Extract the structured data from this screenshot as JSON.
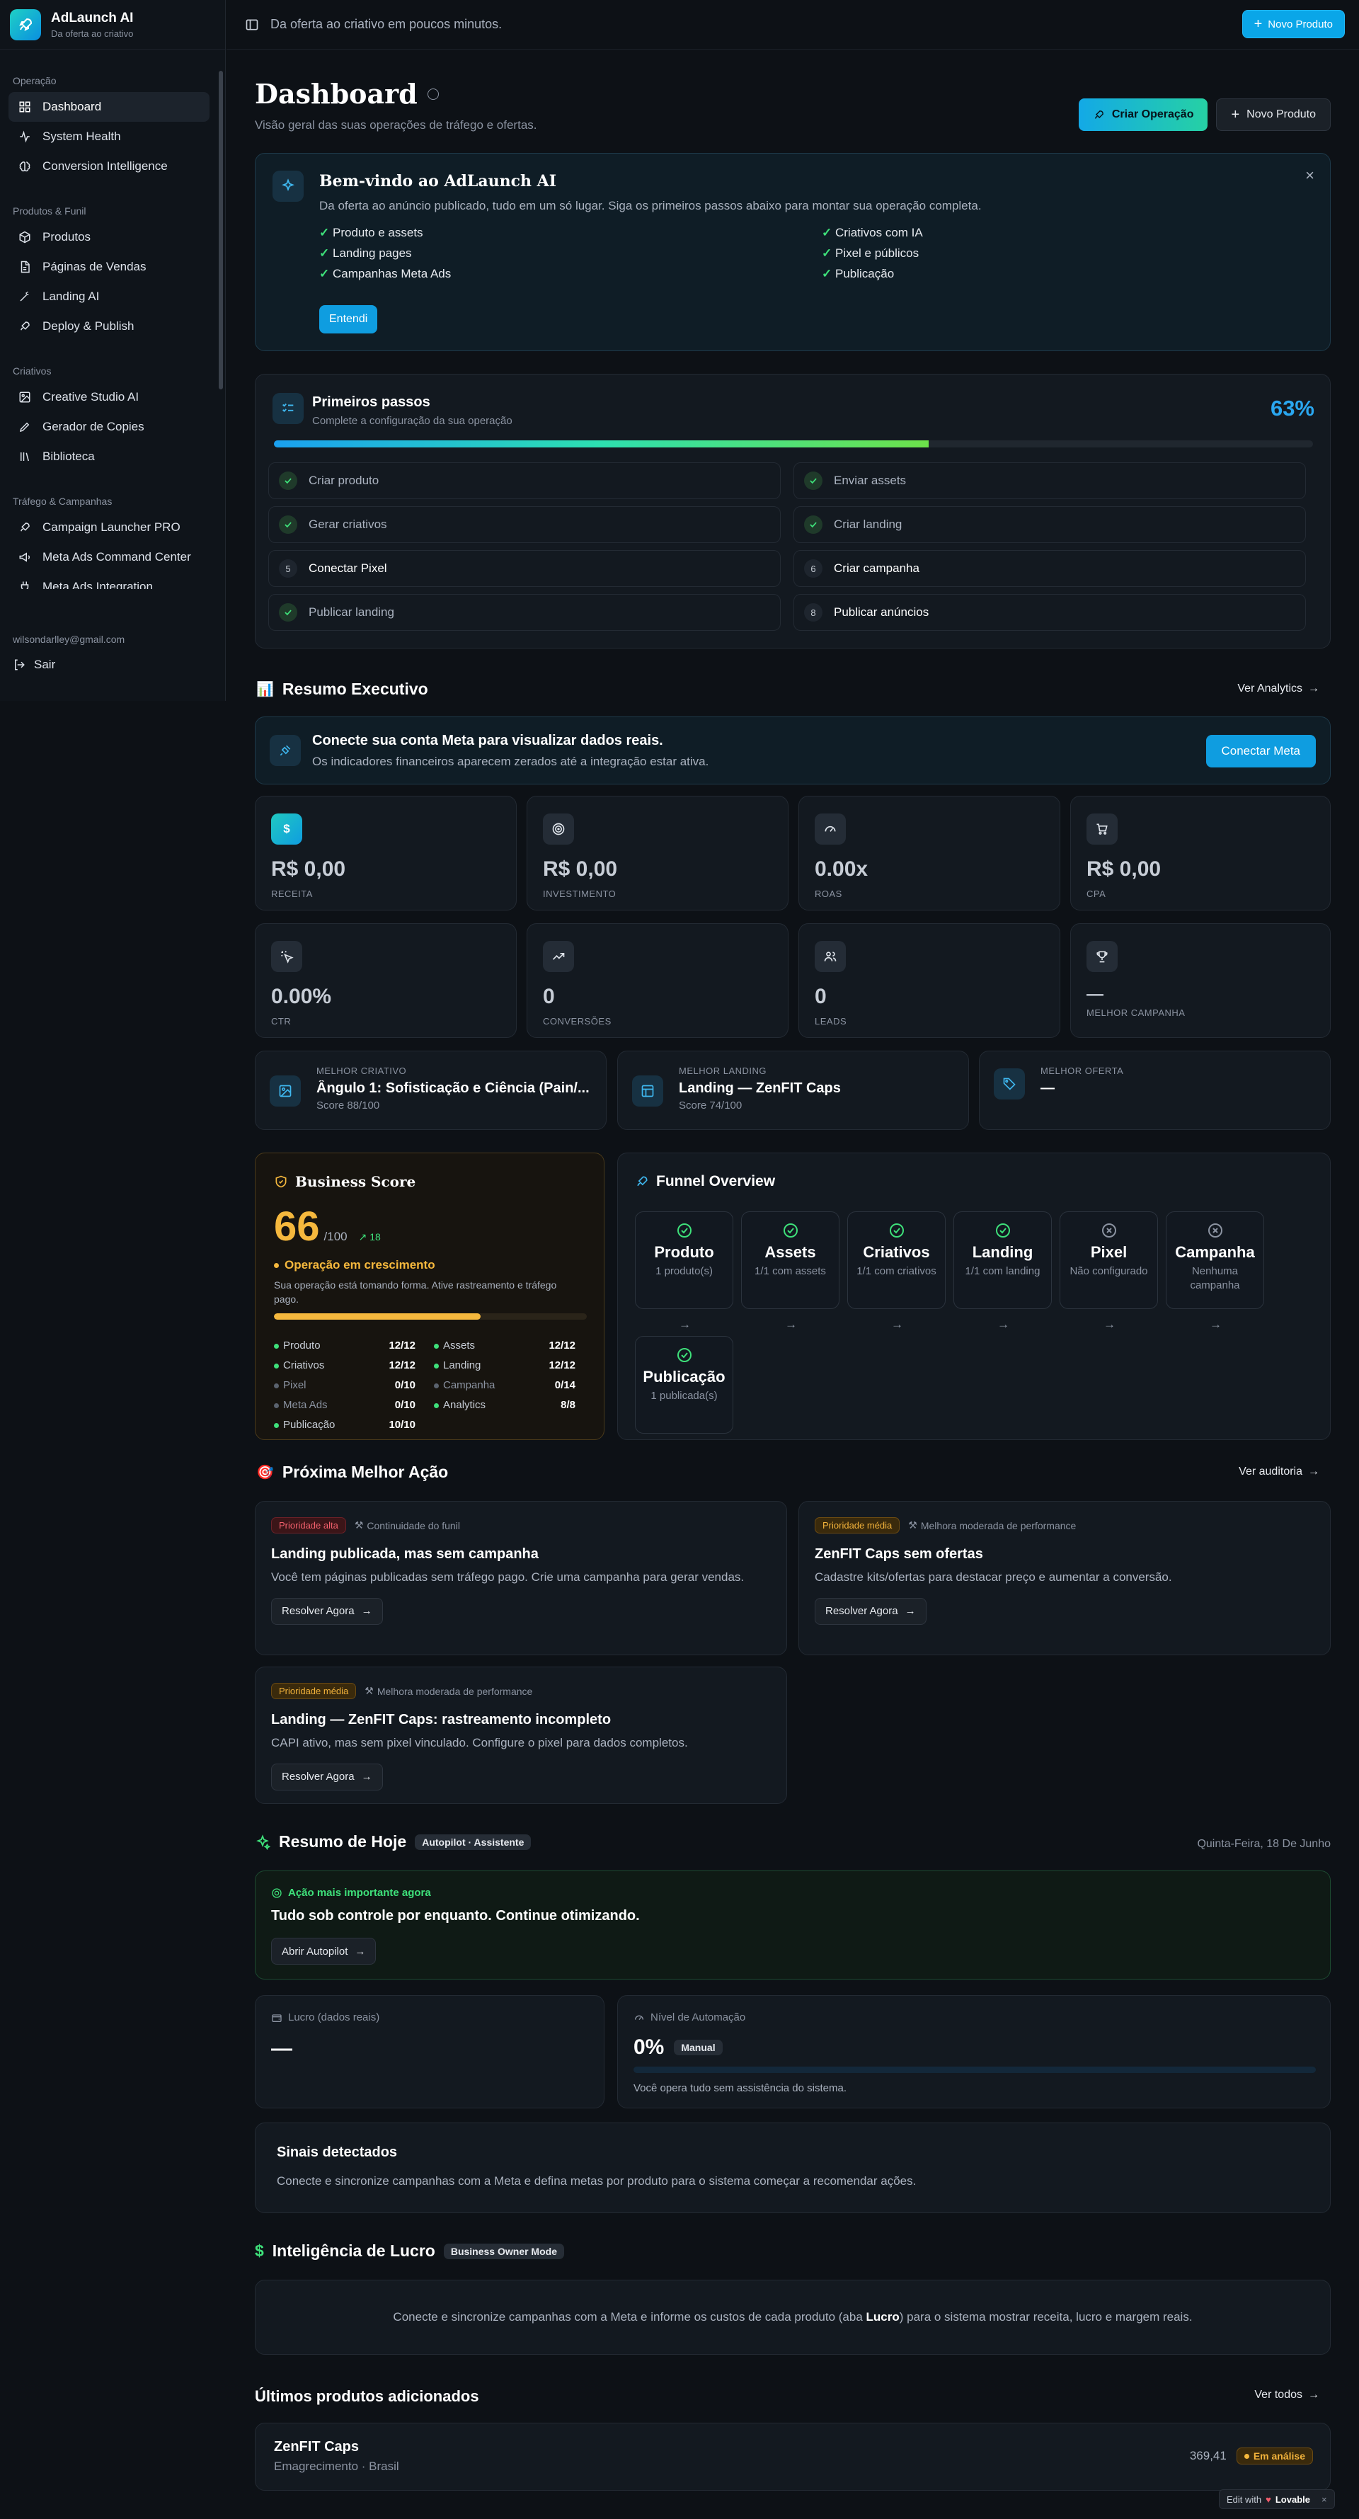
{
  "sidebar": {
    "brand_title": "AdLaunch AI",
    "brand_subtitle": "Da oferta ao criativo",
    "sections": [
      {
        "title": "Operação",
        "items": [
          "Dashboard",
          "System Health",
          "Conversion Intelligence"
        ]
      },
      {
        "title": "Produtos & Funil",
        "items": [
          "Produtos",
          "Páginas de Vendas",
          "Landing AI",
          "Deploy & Publish"
        ]
      },
      {
        "title": "Criativos",
        "items": [
          "Creative Studio AI",
          "Gerador de Copies",
          "Biblioteca"
        ]
      },
      {
        "title": "Tráfego & Campanhas",
        "items": [
          "Campaign Launcher PRO",
          "Meta Ads Command Center",
          "Meta Ads Integration"
        ]
      }
    ],
    "email": "wilsondarlley@gmail.com",
    "logout": "Sair"
  },
  "topbar": {
    "tagline": "Da oferta ao criativo em poucos minutos.",
    "new_product": "Novo Produto"
  },
  "header": {
    "title": "Dashboard",
    "subtitle": "Visão geral das suas operações de tráfego e ofertas.",
    "create_op": "Criar Operação",
    "new_product": "Novo Produto"
  },
  "welcome": {
    "title": "Bem-vindo ao AdLaunch AI",
    "subtitle": "Da oferta ao anúncio publicado, tudo em um só lugar. Siga os primeiros passos abaixo para montar sua operação completa.",
    "items": [
      "Produto e assets",
      "Criativos com IA",
      "Landing pages",
      "Pixel e públicos",
      "Campanhas Meta Ads",
      "Publicação"
    ],
    "button": "Entendi"
  },
  "first_steps": {
    "title": "Primeiros passos",
    "subtitle": "Complete a configuração da sua operação",
    "percent_label": "63%",
    "progress": 0.63,
    "steps": [
      {
        "num": "1",
        "label": "Criar produto",
        "done": true
      },
      {
        "num": "2",
        "label": "Enviar assets",
        "done": true
      },
      {
        "num": "3",
        "label": "Gerar criativos",
        "done": true
      },
      {
        "num": "4",
        "label": "Criar landing",
        "done": true
      },
      {
        "num": "5",
        "label": "Conectar Pixel",
        "done": false
      },
      {
        "num": "6",
        "label": "Criar campanha",
        "done": false
      },
      {
        "num": "7",
        "label": "Publicar landing",
        "done": true
      },
      {
        "num": "8",
        "label": "Publicar anúncios",
        "done": false
      }
    ]
  },
  "executive": {
    "title": "Resumo Executivo",
    "link": "Ver Analytics",
    "meta_title": "Conecte sua conta Meta para visualizar dados reais.",
    "meta_sub": "Os indicadores financeiros aparecem zerados até a integração estar ativa.",
    "meta_btn": "Conectar Meta",
    "kpis": [
      {
        "icon": "dollar-icon",
        "value": "R$ 0,00",
        "label": "RECEITA"
      },
      {
        "icon": "target-icon",
        "value": "R$ 0,00",
        "label": "INVESTIMENTO"
      },
      {
        "icon": "gauge-icon",
        "value": "0.00x",
        "label": "ROAS"
      },
      {
        "icon": "cart-icon",
        "value": "R$ 0,00",
        "label": "CPA"
      },
      {
        "icon": "click-icon",
        "value": "0.00%",
        "label": "CTR"
      },
      {
        "icon": "trend-icon",
        "value": "0",
        "label": "CONVERSÕES"
      },
      {
        "icon": "users-icon",
        "value": "0",
        "label": "LEADS"
      },
      {
        "icon": "trophy-icon",
        "value": "—",
        "label": "MELHOR CAMPANHA"
      }
    ],
    "best": [
      {
        "label": "MELHOR CRIATIVO",
        "title": "Ângulo 1: Sofisticação e Ciência (Pain/...",
        "score": "Score 88/100"
      },
      {
        "label": "MELHOR LANDING",
        "title": "Landing — ZenFIT Caps",
        "score": "Score 74/100"
      },
      {
        "label": "MELHOR OFERTA",
        "title": "—",
        "score": ""
      }
    ]
  },
  "business_score": {
    "title": "Business Score",
    "score": "66",
    "max": "/100",
    "delta": "18",
    "status": "Operação em crescimento",
    "desc": "Sua operação está tomando forma. Ative rastreamento e tráfego pago.",
    "progress": 0.66,
    "rows": [
      {
        "label": "Produto",
        "value": "12/12",
        "ok": true
      },
      {
        "label": "Assets",
        "value": "12/12",
        "ok": true
      },
      {
        "label": "Criativos",
        "value": "12/12",
        "ok": true
      },
      {
        "label": "Landing",
        "value": "12/12",
        "ok": true
      },
      {
        "label": "Pixel",
        "value": "0/10",
        "ok": false
      },
      {
        "label": "Campanha",
        "value": "0/14",
        "ok": false
      },
      {
        "label": "Meta Ads",
        "value": "0/10",
        "ok": false
      },
      {
        "label": "Analytics",
        "value": "8/8",
        "ok": true
      },
      {
        "label": "Publicação",
        "value": "10/10",
        "ok": true
      }
    ],
    "colors": {
      "accent": "#f5b83d",
      "ok": "#3ee07a"
    }
  },
  "funnel": {
    "title": "Funnel Overview",
    "nodes": [
      {
        "name": "Produto",
        "status": "1 produto(s)",
        "ok": true
      },
      {
        "name": "Assets",
        "status": "1/1 com assets",
        "ok": true
      },
      {
        "name": "Criativos",
        "status": "1/1 com criativos",
        "ok": true
      },
      {
        "name": "Landing",
        "status": "1/1 com landing",
        "ok": true
      },
      {
        "name": "Pixel",
        "status": "Não configurado",
        "ok": false
      },
      {
        "name": "Campanha",
        "status": "Nenhuma campanha",
        "ok": false
      },
      {
        "name": "Publicação",
        "status": "1 publicada(s)",
        "ok": true
      }
    ]
  },
  "next_action": {
    "title": "Próxima Melhor Ação",
    "link": "Ver auditoria",
    "items": [
      {
        "priority": "Prioridade alta",
        "level": "high",
        "category": "Continuidade do funil",
        "title": "Landing publicada, mas sem campanha",
        "desc": "Você tem páginas publicadas sem tráfego pago. Crie uma campanha para gerar vendas.",
        "button": "Resolver Agora"
      },
      {
        "priority": "Prioridade média",
        "level": "medium",
        "category": "Melhora moderada de performance",
        "title": "ZenFIT Caps sem ofertas",
        "desc": "Cadastre kits/ofertas para destacar preço e aumentar a conversão.",
        "button": "Resolver Agora"
      },
      {
        "priority": "Prioridade média",
        "level": "medium",
        "category": "Melhora moderada de performance",
        "title": "Landing — ZenFIT Caps: rastreamento incompleto",
        "desc": "CAPI ativo, mas sem pixel vinculado. Configure o pixel para dados completos.",
        "button": "Resolver Agora"
      }
    ]
  },
  "today": {
    "title": "Resumo de Hoje",
    "badge": "Autopilot · Assistente",
    "date": "Quinta-Feira, 18 De Junho",
    "key_label": "Ação mais importante agora",
    "key_title": "Tudo sob controle por enquanto. Continue otimizando.",
    "key_button": "Abrir Autopilot",
    "profit_label": "Lucro (dados reais)",
    "profit_value": "—",
    "automation_label": "Nível de Automação",
    "automation_value": "0%",
    "automation_mode": "Manual",
    "automation_progress": 0,
    "automation_desc": "Você opera tudo sem assistência do sistema.",
    "signals_title": "Sinais detectados",
    "signals_desc": "Conecte e sincronize campanhas com a Meta e defina metas por produto para o sistema começar a recomendar ações."
  },
  "profit": {
    "title": "Inteligência de Lucro",
    "badge": "Business Owner Mode",
    "msg_pre": "Conecte e sincronize campanhas com a Meta e informe os custos de cada produto (aba ",
    "msg_bold": "Lucro",
    "msg_post": ") para o sistema mostrar receita, lucro e margem reais."
  },
  "products": {
    "title": "Últimos produtos adicionados",
    "link": "Ver todos",
    "items": [
      {
        "name": "ZenFIT Caps",
        "meta": "Emagrecimento · Brasil",
        "price": "369,41",
        "status": "Em análise"
      }
    ]
  },
  "lovable": {
    "text": "Edit with",
    "brand": "Lovable"
  }
}
